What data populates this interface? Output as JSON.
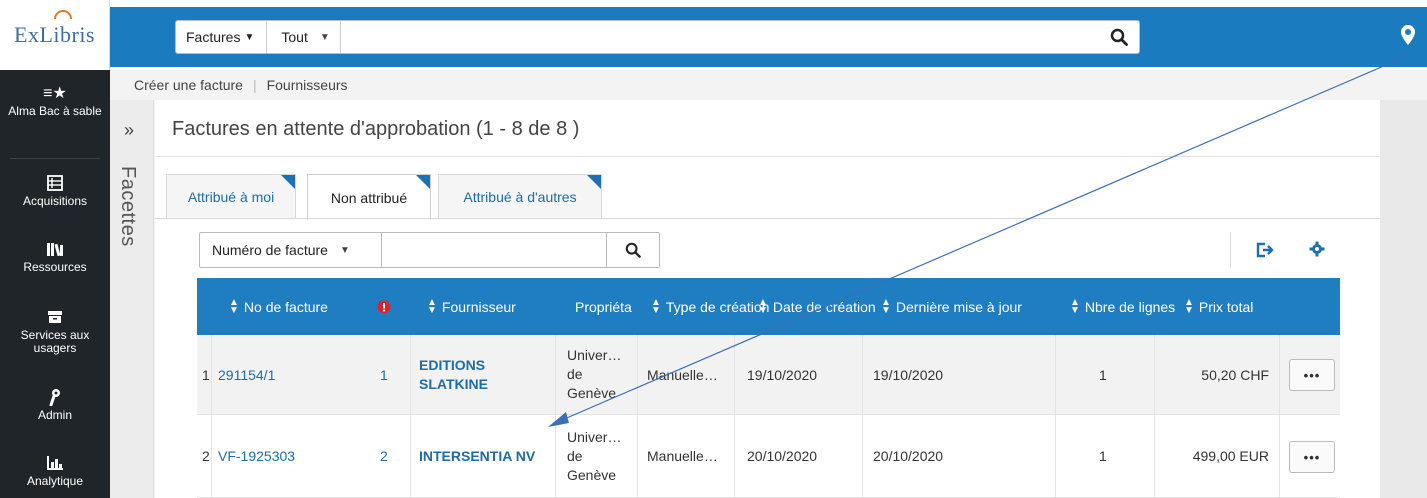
{
  "header": {
    "logo_text": "ExLibris",
    "scope_primary": "Factures",
    "scope_secondary": "Tout",
    "search_value": ""
  },
  "nav": {
    "items": [
      {
        "label": "Alma Bac à sable",
        "icon": "sandbox-star-icon"
      },
      {
        "label": "Acquisitions",
        "icon": "abacus-icon"
      },
      {
        "label": "Ressources",
        "icon": "books-icon"
      },
      {
        "label": "Services aux usagers",
        "icon": "archive-box-icon"
      },
      {
        "label": "Admin",
        "icon": "wrench-icon"
      },
      {
        "label": "Analytique",
        "icon": "bar-chart-icon"
      }
    ]
  },
  "breadcrumb": {
    "items": [
      "Créer une facture",
      "Fournisseurs"
    ]
  },
  "facets": {
    "label": "Facettes",
    "toggle": "»"
  },
  "page": {
    "title": "Factures en attente d'approbation (1 - 8 de 8 )"
  },
  "tabs": [
    {
      "label": "Attribué à moi",
      "active": false
    },
    {
      "label": "Non attribué",
      "active": true
    },
    {
      "label": "Attribué à d'autres",
      "active": false
    }
  ],
  "filter": {
    "field_label": "Numéro de facture",
    "value": ""
  },
  "table": {
    "columns": [
      {
        "label": "No de facture",
        "sortable": true
      },
      {
        "label": "!",
        "sortable": false,
        "icon": "alert-icon"
      },
      {
        "label": "Fournisseur",
        "sortable": true
      },
      {
        "label": "Propriéta",
        "sortable": false
      },
      {
        "label": "Type de création",
        "sortable": true
      },
      {
        "label": "Date de création",
        "sortable": true
      },
      {
        "label": "Dernière mise à jour",
        "sortable": true
      },
      {
        "label": "Nbre de lignes",
        "sortable": true
      },
      {
        "label": "Prix total",
        "sortable": true
      }
    ],
    "rows": [
      {
        "index": "1",
        "number": "291154/1",
        "alerts": "1",
        "vendor_line1": "EDITIONS",
        "vendor_line2": "SLATKINE",
        "owner_line1": "Univer…",
        "owner_line2": "de",
        "owner_line3": "Genève",
        "creation_type": "Manuelle…",
        "created": "19/10/2020",
        "updated": "19/10/2020",
        "lines": "1",
        "total": "50,20 CHF",
        "more": "•••"
      },
      {
        "index": "2",
        "number": "VF-1925303",
        "alerts": "2",
        "vendor_line1": "INTERSENTIA NV",
        "vendor_line2": "",
        "owner_line1": "Univer…",
        "owner_line2": "de",
        "owner_line3": "Genève",
        "creation_type": "Manuelle…",
        "created": "20/10/2020",
        "updated": "20/10/2020",
        "lines": "1",
        "total": "499,00 EUR",
        "more": "•••"
      }
    ]
  },
  "colors": {
    "header_blue": "#1a7bbf",
    "table_header_blue": "#1f7dc2",
    "link_blue": "#1d6ca9",
    "nav_dark": "#1f2529",
    "alert_red": "#d9262c",
    "annotation_arrow": "#3d6fb6"
  }
}
